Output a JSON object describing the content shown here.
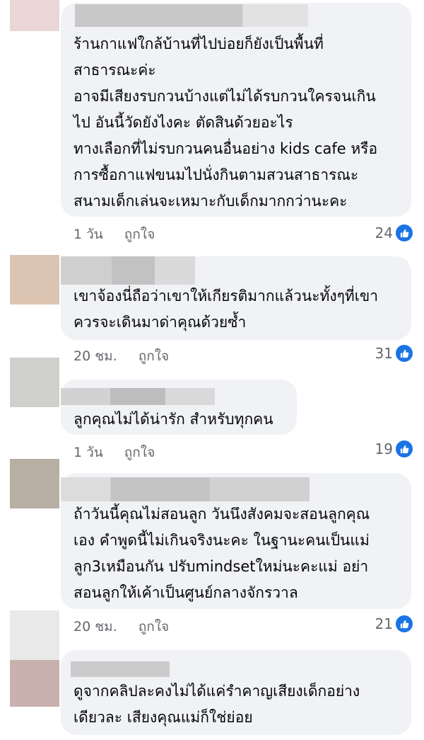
{
  "comments": [
    {
      "text": "ร้านกาแฟใกล้บ้านที่ไปบ่อยก็ยังเป็นพื้นที่\nสาธารณะค่ะ\nอาจมีเสียงรบกวนบ้างแต่ไม่ได้รบกวนใครจนเกิน\nไป อันนี้วัดยังไงคะ ตัดสินด้วยอะไร\nทางเลือกที่ไม่รบกวนคนอื่นอย่าง kids cafe หรือ\nการซื้อกาแฟขนมไปนั่งกินตามสวนสาธารณะ\nสนามเด็กเล่นจะเหมาะกับเด็กมากกว่านะคะ",
      "time": "1 วัน",
      "like_label": "ถูกใจ",
      "reactions": "24"
    },
    {
      "text": "เขาจ้องนี่ถือว่าเขาให้เกียรติมากแล้วนะทั้งๆที่เขา\nควรจะเดินมาด่าคุณด้วยซ้ำ",
      "time": "20 ชม.",
      "like_label": "ถูกใจ",
      "reactions": "31"
    },
    {
      "text": "ลูกคุณไม่ได้น่ารัก สำหรับทุกคน",
      "time": "1 วัน",
      "like_label": "ถูกใจ",
      "reactions": "19"
    },
    {
      "text": "ถ้าวันนี้คุณไม่สอนลูก วันนึงสังคมจะสอนลูกคุณ\nเอง คำพูดนี้ไม่เกินจริงนะคะ ในฐานะคนเป็นแม่\nลูก3เหมือนกัน ปรับmindsetใหม่นะคะแม่ อย่า\nสอนลูกให้เค้าเป็นศูนย์กลางจักรวาล",
      "time": "20 ชม.",
      "like_label": "ถูกใจ",
      "reactions": "21"
    },
    {
      "text": "ดูจากคลิปละคงไม่ได้แค่รำคาญเสียงเด็กอย่าง\nเดียวละ เสียงคุณแม่ก็ใช่ย่อย"
    }
  ],
  "colors": {
    "bubble": "#f0f2f5",
    "meta_text": "#65676b",
    "like_blue": "#1b74e4"
  },
  "icons": [
    "like-icon"
  ]
}
